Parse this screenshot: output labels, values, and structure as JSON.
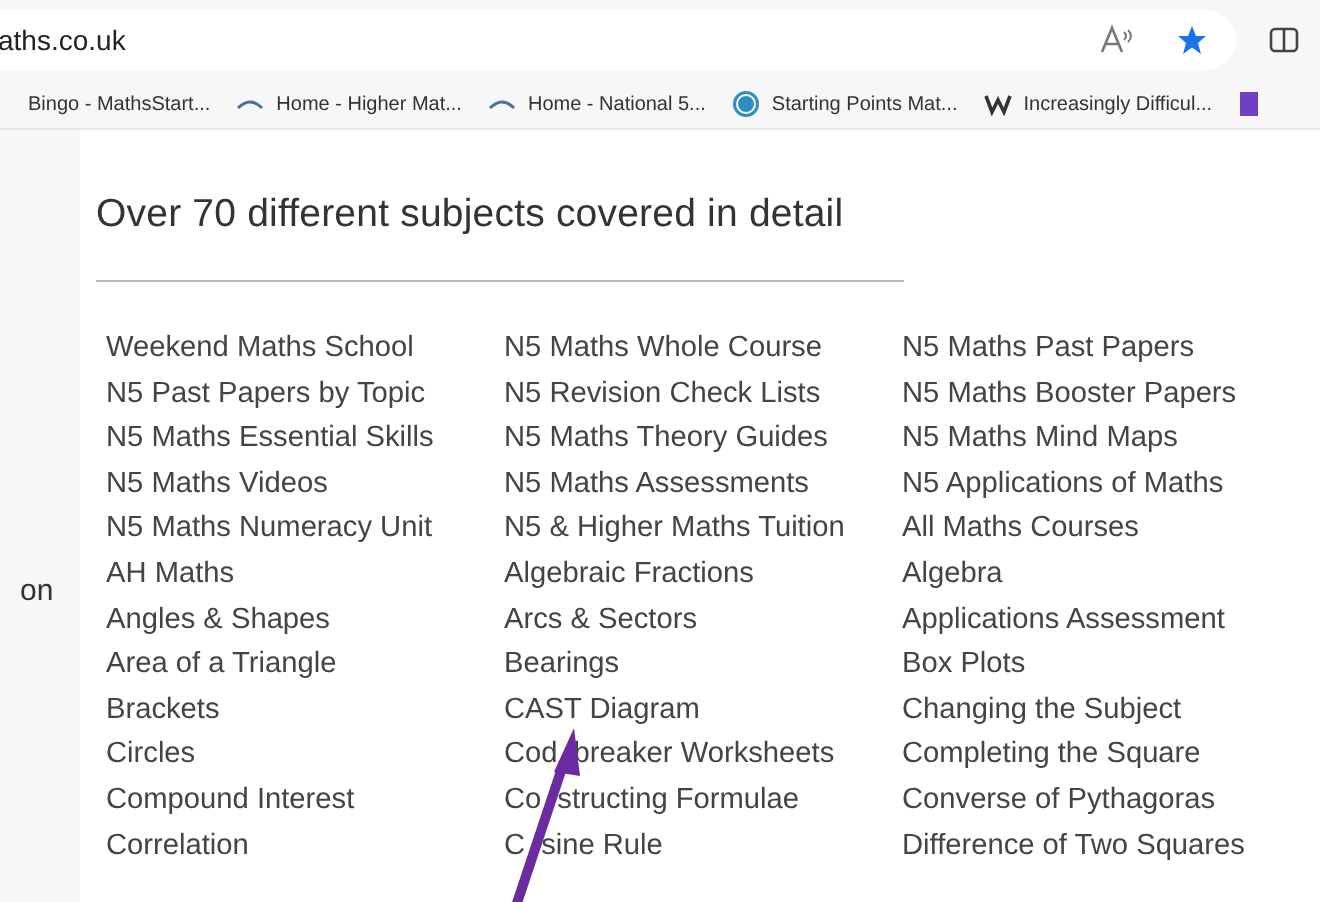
{
  "address_bar": {
    "url": "aths.co.uk"
  },
  "bookmarks": [
    {
      "label": "Bingo - MathsStart...",
      "kind": "none"
    },
    {
      "label": "Home - Higher Mat...",
      "kind": "arc"
    },
    {
      "label": "Home - National 5...",
      "kind": "arc"
    },
    {
      "label": "Starting Points Mat...",
      "kind": "wp"
    },
    {
      "label": "Increasingly Difficul...",
      "kind": "w"
    }
  ],
  "sidebar": {
    "fragment": "on"
  },
  "heading": "Over 70 different subjects covered in detail",
  "columns": [
    [
      "Weekend Maths School",
      "N5 Past Papers by Topic",
      "N5 Maths Essential Skills",
      "N5 Maths Videos",
      "N5 Maths Numeracy Unit",
      "AH Maths",
      "Angles & Shapes",
      "Area of a Triangle",
      "Brackets",
      "Circles",
      "Compound Interest",
      "Correlation"
    ],
    [
      "N5 Maths Whole Course",
      "N5 Revision Check Lists",
      "N5 Maths Theory Guides",
      "N5 Maths Assessments",
      "N5 & Higher Maths Tuition",
      "Algebraic Fractions",
      "Arcs & Sectors",
      "Bearings",
      "CAST Diagram",
      [
        "Cod",
        "breaker Worksheets"
      ],
      [
        "Co",
        "structing Formulae"
      ],
      [
        "C",
        "sine Rule"
      ]
    ],
    [
      "N5 Maths Past Papers",
      "N5 Maths Booster Papers",
      "N5 Maths Mind Maps",
      "N5 Applications of Maths",
      "All Maths Courses",
      "Algebra",
      "Applications Assessment",
      "Box Plots",
      "Changing the Subject",
      "Completing the Square",
      "Converse of Pythagoras",
      "Difference of Two Squares"
    ]
  ]
}
